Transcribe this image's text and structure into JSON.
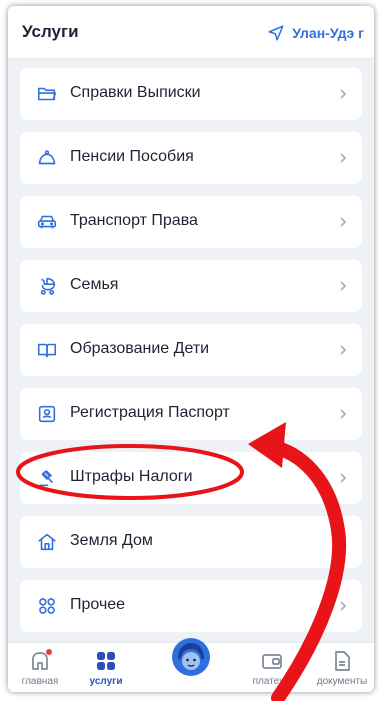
{
  "header": {
    "title": "Услуги",
    "location": "Улан-Удэ г"
  },
  "services": [
    {
      "label": "Справки Выписки",
      "icon": "folder-icon"
    },
    {
      "label": "Пенсии Пособия",
      "icon": "pension-icon"
    },
    {
      "label": "Транспорт Права",
      "icon": "car-icon"
    },
    {
      "label": "Семья",
      "icon": "stroller-icon"
    },
    {
      "label": "Образование Дети",
      "icon": "book-icon"
    },
    {
      "label": "Регистрация Паспорт",
      "icon": "passport-icon"
    },
    {
      "label": "Штрафы Налоги",
      "icon": "gavel-icon"
    },
    {
      "label": "Земля Дом",
      "icon": "home-icon"
    },
    {
      "label": "Прочее",
      "icon": "grid-icon"
    }
  ],
  "tabbar": {
    "home": "главная",
    "services": "услуги",
    "payments": "платежи",
    "documents": "документы"
  },
  "colors": {
    "accent": "#2f6fe0",
    "annotation": "#e8141a"
  }
}
